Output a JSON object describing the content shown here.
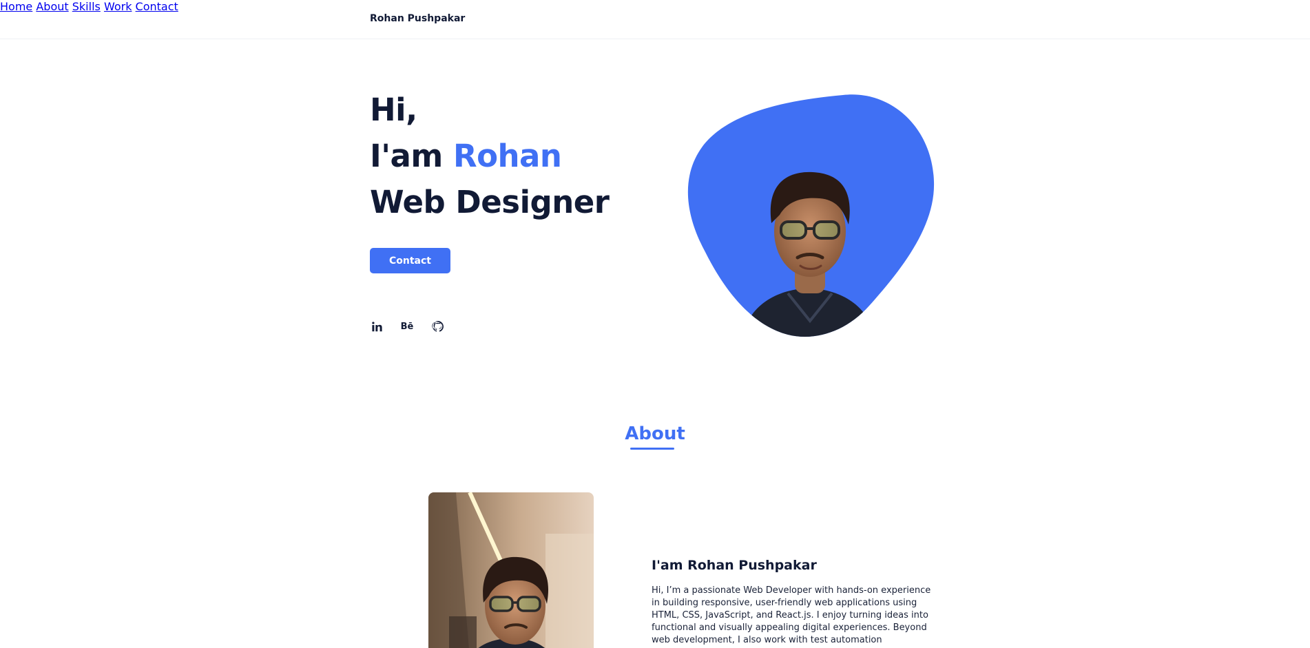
{
  "header": {
    "brand": "Rohan Pushpakar",
    "nav": [
      {
        "label": "Home",
        "active": true
      },
      {
        "label": "About",
        "active": false
      },
      {
        "label": "Skills",
        "active": false
      },
      {
        "label": "Work",
        "active": false
      },
      {
        "label": "Contact",
        "active": false
      }
    ]
  },
  "hero": {
    "line1": "Hi,",
    "line2_prefix": "I'am ",
    "line2_name": "Rohan",
    "line3": "Web Designer",
    "cta_label": "Contact",
    "social": [
      "linkedin-icon",
      "behance-icon",
      "github-icon"
    ],
    "behance_glyph": "Bē"
  },
  "about": {
    "title": "About",
    "heading": "I'am Rohan Pushpakar",
    "text": "Hi, I’m a passionate Web Developer with hands-on experience in building responsive, user-friendly web applications using HTML, CSS, JavaScript, and React.js. I enjoy turning ideas into functional and visually appealing digital experiences. Beyond web development, I also work with test automation frameworks"
  },
  "colors": {
    "accent": "#4070f4",
    "dark": "#111a35"
  }
}
